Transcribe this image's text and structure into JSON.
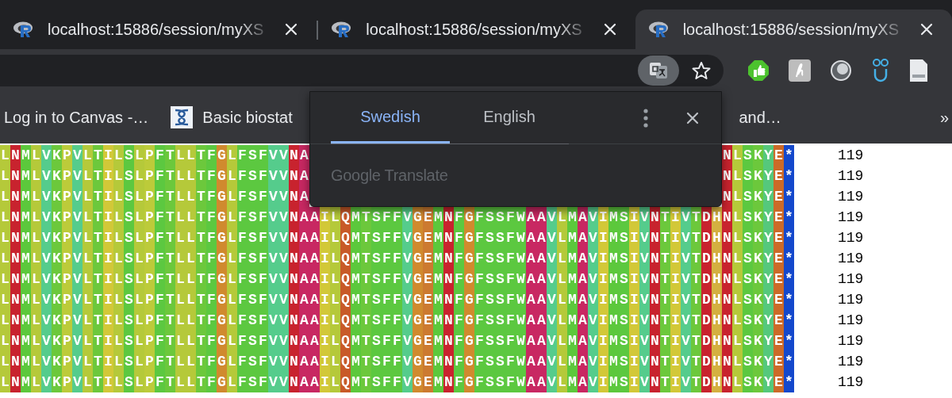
{
  "tabs": [
    {
      "title": "localhost:15886/session/myXS",
      "selected": false
    },
    {
      "title": "localhost:15886/session/myXS",
      "selected": false
    },
    {
      "title": "localhost:15886/session/myXS",
      "selected": true
    }
  ],
  "bookmarks": [
    {
      "label": "Log in to Canvas -…",
      "kind": "plain"
    },
    {
      "label": "Basic biostat",
      "kind": "icon"
    },
    {
      "label": "and…",
      "kind": "plain"
    }
  ],
  "bookmarks_overflow": "»",
  "translate_popup": {
    "tabs": [
      {
        "label": "Swedish",
        "selected": true
      },
      {
        "label": "English",
        "selected": false
      }
    ],
    "brand": "Google Translate"
  },
  "alignment": {
    "columns": [
      {
        "color": "#b5c93a"
      },
      {
        "color": "#c8232e"
      },
      {
        "color": "#5cc83c"
      },
      {
        "color": "#b5c93a"
      },
      {
        "color": "#55cc8c"
      },
      {
        "color": "#6cc83c"
      },
      {
        "color": "#bccb3a"
      },
      {
        "color": "#55cc8c"
      },
      {
        "color": "#b5c93a"
      },
      {
        "color": "#6cc83c"
      },
      {
        "color": "#d2c838"
      },
      {
        "color": "#b5c93a"
      },
      {
        "color": "#5cc840"
      },
      {
        "color": "#b5c93a"
      },
      {
        "color": "#bccb3a"
      },
      {
        "color": "#5cc840"
      },
      {
        "color": "#6cc83c"
      },
      {
        "color": "#b5c93a"
      },
      {
        "color": "#b5c93a"
      },
      {
        "color": "#6cc83c"
      },
      {
        "color": "#5cc840"
      },
      {
        "color": "#d08a2e"
      },
      {
        "color": "#b5c93a"
      },
      {
        "color": "#5cc840"
      },
      {
        "color": "#5cc840"
      },
      {
        "color": "#5cc840"
      },
      {
        "color": "#55cc8c"
      },
      {
        "color": "#55cc8c"
      },
      {
        "color": "#c8232e"
      },
      {
        "color": "#c82862"
      },
      {
        "color": "#c82862"
      },
      {
        "color": "#d2c838"
      },
      {
        "color": "#b5c93a"
      },
      {
        "color": "#c85a28"
      },
      {
        "color": "#5cc83c"
      },
      {
        "color": "#6cc83c"
      },
      {
        "color": "#5cc840"
      },
      {
        "color": "#5cc840"
      },
      {
        "color": "#5cc840"
      },
      {
        "color": "#55cc8c"
      },
      {
        "color": "#d08a2e"
      },
      {
        "color": "#cc7a30"
      },
      {
        "color": "#5cc83c"
      },
      {
        "color": "#c8232e"
      },
      {
        "color": "#5cc840"
      },
      {
        "color": "#d08a2e"
      },
      {
        "color": "#5cc840"
      },
      {
        "color": "#5cc840"
      },
      {
        "color": "#5cc840"
      },
      {
        "color": "#5cc840"
      },
      {
        "color": "#5cc840"
      },
      {
        "color": "#c82862"
      },
      {
        "color": "#c82862"
      },
      {
        "color": "#55cc8c"
      },
      {
        "color": "#b5c93a"
      },
      {
        "color": "#5cc83c"
      },
      {
        "color": "#c82862"
      },
      {
        "color": "#55cc8c"
      },
      {
        "color": "#d2c838"
      },
      {
        "color": "#5cc83c"
      },
      {
        "color": "#5cc840"
      },
      {
        "color": "#d2c838"
      },
      {
        "color": "#55cc8c"
      },
      {
        "color": "#c8232e"
      },
      {
        "color": "#6cc83c"
      },
      {
        "color": "#d2c838"
      },
      {
        "color": "#55cc8c"
      },
      {
        "color": "#6cc83c"
      },
      {
        "color": "#c8232e"
      },
      {
        "color": "#d4b040"
      },
      {
        "color": "#c8232e"
      },
      {
        "color": "#b5c93a"
      },
      {
        "color": "#5cc840"
      },
      {
        "color": "#6cc83c"
      },
      {
        "color": "#55c87c"
      },
      {
        "color": "#cc6a28"
      },
      {
        "color": "#1448cc"
      }
    ],
    "rows": [
      {
        "kind": "covered",
        "left": "LNMLVKPVLTILSLPFTLLTFGLFSFVVNA",
        "right": "NLSKYE*",
        "count": "119"
      },
      {
        "kind": "covered",
        "left": "LNMLVKPVLTILSLPFTLLTFGLFSFVVNA",
        "right": "NLSKYE*",
        "count": "119"
      },
      {
        "kind": "covered",
        "left": "LNMLVKPVLTILSLPFTLLTFGLFSFVVNA",
        "right": "NLSKYE*",
        "count": "119"
      },
      {
        "kind": "full",
        "sequence": "LNMLVKPVLTILSLPFTLLTFGLFSFVVNAAILQMTSFFVGEMNFGFSSFWAAVLMAVIMSIVNTIVTDHNLSKYE*",
        "count": "119"
      },
      {
        "kind": "full",
        "sequence": "LNMLVKPVLTILSLPFTLLTFGLFSFVVNAAILQMTSFFVGEMNFGFSSFWAAVLMAVIMSIVNTIVTDHNLSKYE*",
        "count": "119"
      },
      {
        "kind": "full",
        "sequence": "LNMLVKPVLTILSLPFTLLTFGLFSFVVNAAILQMTSFFVGEMNFGFSSFWAAVLMAVIMSIVNTIVTDHNLSKYE*",
        "count": "119"
      },
      {
        "kind": "full",
        "sequence": "LNMLVKPVLTILSLPFTLLTFGLFSFVVNAAILQMTSFFVGEMNFGFSSFWAAVLMAVIMSIVNTIVTDHNLSKYE*",
        "count": "119"
      },
      {
        "kind": "full",
        "sequence": "LNMLVKPVLTILSLPFTLLTFGLFSFVVNAAILQMTSFFVGEMNFGFSSFWAAVLMAVIMSIVNTIVTDHNLSKYE*",
        "count": "119"
      },
      {
        "kind": "full",
        "sequence": "LNMLVKPVLTILSLPFTLLTFGLFSFVVNAAILQMTSFFVGEMNFGFSSFWAAVLMAVIMSIVNTIVTDHNLSKYE*",
        "count": "119"
      },
      {
        "kind": "full",
        "sequence": "LNMLVKPVLTILSLPFTLLTFGLFSFVVNAAILQMTSFFVGEMNFGFSSFWAAVLMAVIMSIVNTIVTDHNLSKYE*",
        "count": "119"
      },
      {
        "kind": "full",
        "sequence": "LNMLVKPVLTILSLPFTLLTFGLFSFVVNAAILQMTSFFVGEMNFGFSSFWAAVLMAVIMSIVNTIVTDHNLSKYE*",
        "count": "119"
      },
      {
        "kind": "full",
        "sequence": "LNMLVKPVLTILSLPFTLLTFGLFSFVVNAAILQMTSFFVGEMNFGFSSFWAAVLMAVIMSIVNTIVTDHNLSKYE*",
        "count": "119"
      }
    ]
  }
}
